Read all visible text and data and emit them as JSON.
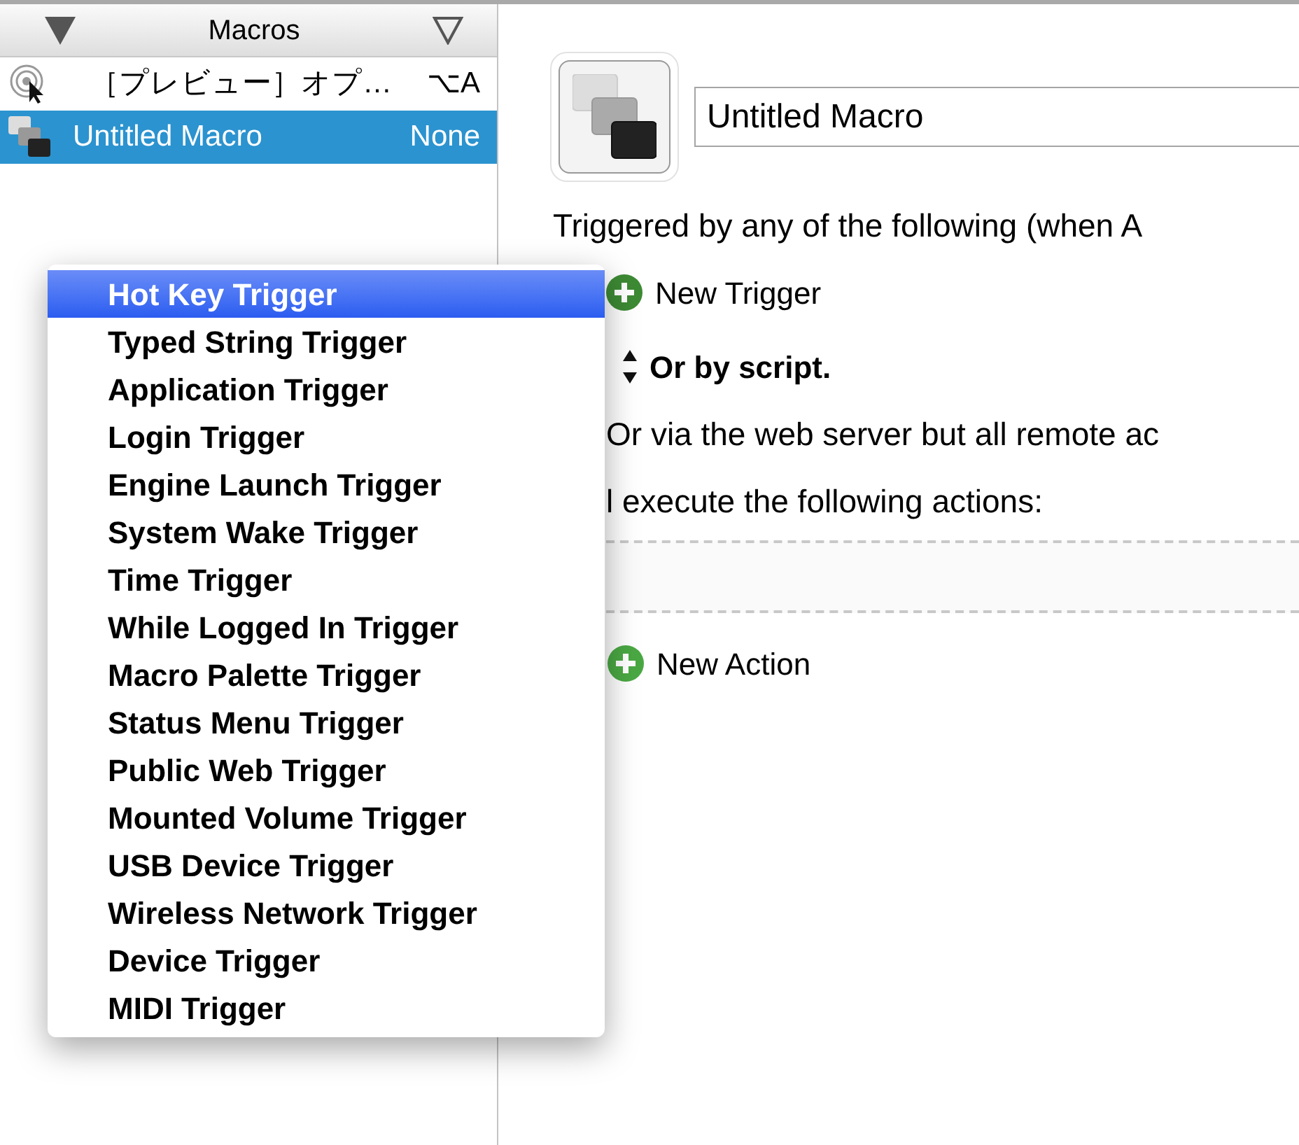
{
  "sidebar": {
    "title": "Macros",
    "macros": [
      {
        "name": "［プレビュー］オプ…",
        "hotkey": "⌥A",
        "selected": false,
        "kind": "target"
      },
      {
        "name": "Untitled Macro",
        "hotkey": "None",
        "selected": true,
        "kind": "stack"
      }
    ]
  },
  "editor": {
    "macro_name": "Untitled Macro",
    "triggered_text": "Triggered by any of the following (when A",
    "new_trigger": "New Trigger",
    "script_label": "Or by script.",
    "web_server_text": "Or via the web server but all remote ac",
    "execute_text": "l execute the following actions:",
    "new_action": "New Action"
  },
  "trigger_menu": {
    "items": [
      {
        "label": "Hot Key Trigger",
        "selected": true
      },
      {
        "label": "Typed String Trigger",
        "selected": false
      },
      {
        "label": "Application Trigger",
        "selected": false
      },
      {
        "label": "Login Trigger",
        "selected": false
      },
      {
        "label": "Engine Launch Trigger",
        "selected": false
      },
      {
        "label": "System Wake Trigger",
        "selected": false
      },
      {
        "label": "Time Trigger",
        "selected": false
      },
      {
        "label": "While Logged In Trigger",
        "selected": false
      },
      {
        "label": "Macro Palette Trigger",
        "selected": false
      },
      {
        "label": "Status Menu Trigger",
        "selected": false
      },
      {
        "label": "Public Web Trigger",
        "selected": false
      },
      {
        "label": "Mounted Volume Trigger",
        "selected": false
      },
      {
        "label": "USB Device Trigger",
        "selected": false
      },
      {
        "label": "Wireless Network Trigger",
        "selected": false
      },
      {
        "label": "Device Trigger",
        "selected": false
      },
      {
        "label": "MIDI Trigger",
        "selected": false
      }
    ]
  }
}
